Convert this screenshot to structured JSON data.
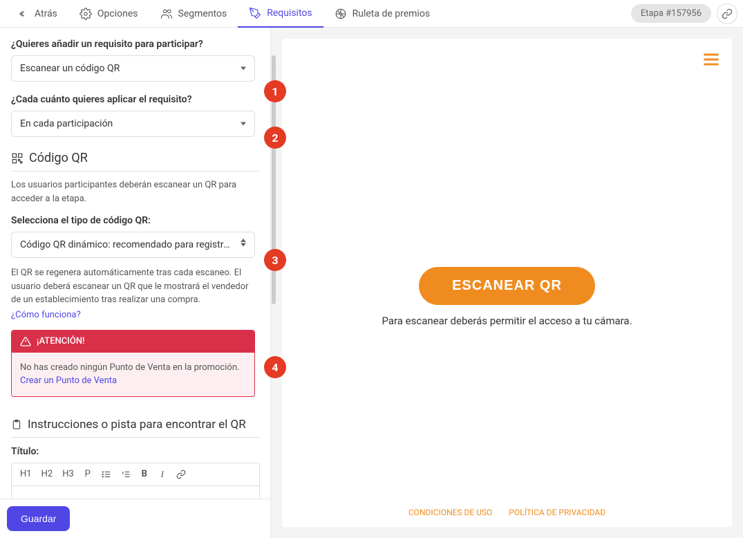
{
  "tabs": {
    "back": "Atrás",
    "options": "Opciones",
    "segments": "Segmentos",
    "requisites": "Requisitos",
    "wheel": "Ruleta de premios"
  },
  "stage_badge": "Etapa #157956",
  "form": {
    "q1_label": "¿Quieres añadir un requisito para participar?",
    "q1_value": "Escanear un código QR",
    "q2_label": "¿Cada cuánto quieres aplicar el requisito?",
    "q2_value": "En cada participación",
    "qr_section_title": "Código QR",
    "qr_description": "Los usuarios participantes deberán escanear un QR para acceder a la etapa.",
    "qr_type_label": "Selecciona el tipo de código QR:",
    "qr_type_value": "Código QR dinámico: recomendado para registrar cor",
    "qr_info": "El QR se regenera automáticamente tras cada escaneo. El usuario deberá escanear un QR que le mostrará el vendedor de un establecimiento tras realizar una compra.",
    "how_link": "¿Cómo funciona?",
    "alert_title": "¡ATENCIÓN!",
    "alert_body_text": "No has creado ningún Punto de Venta en la promoción. ",
    "alert_link": "Crear un Punto de Venta",
    "instructions_section": "Instrucciones o pista para encontrar el QR",
    "title_label": "Título:",
    "toolbar": {
      "h1": "H1",
      "h2": "H2",
      "h3": "H3",
      "p": "P",
      "b": "B",
      "i": "I"
    }
  },
  "save_button": "Guardar",
  "preview": {
    "scan_button": "ESCANEAR QR",
    "scan_text": "Para escanear deberás permitir el acceso a tu cámara.",
    "footer_terms": "CONDICIONES DE USO",
    "footer_privacy": "POLÍTICA DE PRIVACIDAD"
  },
  "badges": {
    "b1": "1",
    "b2": "2",
    "b3": "3",
    "b4": "4"
  }
}
